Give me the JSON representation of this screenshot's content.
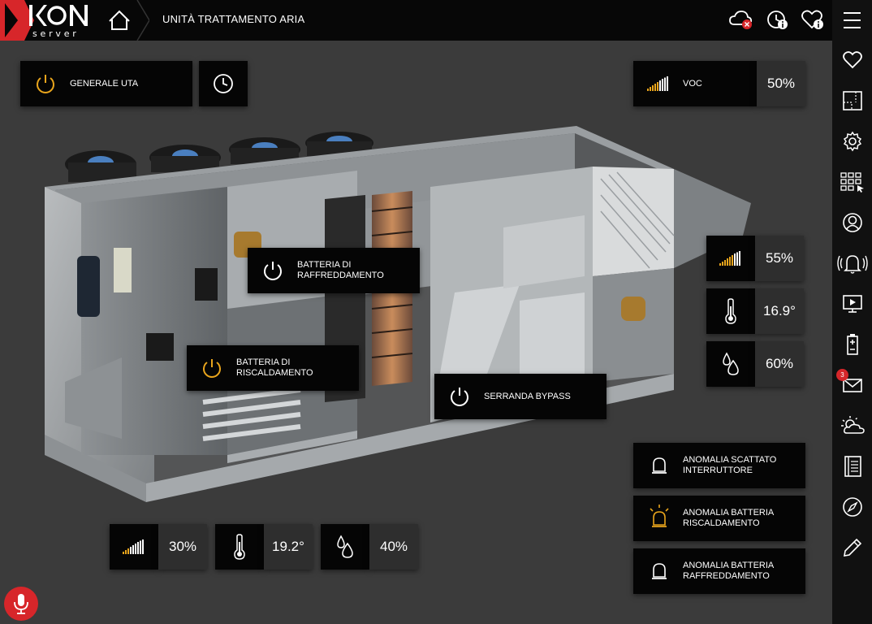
{
  "header": {
    "logo_text": "KON",
    "logo_sub": "server",
    "title": "UNITÀ TRATTAMENTO ARIA"
  },
  "sidebar": {
    "items": [
      {
        "icon": "heart-icon"
      },
      {
        "icon": "floorplan-icon"
      },
      {
        "icon": "gear-icon"
      },
      {
        "icon": "grid-select-icon"
      },
      {
        "icon": "user-icon"
      },
      {
        "icon": "bell-icon"
      },
      {
        "icon": "monitor-play-icon"
      },
      {
        "icon": "battery-icon"
      },
      {
        "icon": "mail-icon",
        "badge": "3"
      },
      {
        "icon": "weather-icon"
      },
      {
        "icon": "notebook-icon"
      },
      {
        "icon": "compass-icon"
      },
      {
        "icon": "pencil-icon"
      }
    ]
  },
  "controls": {
    "generale_uta": "GENERALE UTA",
    "batteria_raffreddamento": "BATTERIA DI\nRAFFREDDAMENTO",
    "batteria_riscaldamento": "BATTERIA DI\nRISCALDAMENTO",
    "serranda_bypass": "SERRANDA BYPASS"
  },
  "sensors": {
    "voc_label": "VOC",
    "voc_value": "50%",
    "right_level": "55%",
    "right_temp": "16.9°",
    "right_humidity": "60%",
    "bottom_level": "30%",
    "bottom_temp": "19.2°",
    "bottom_humidity": "40%"
  },
  "alarms": [
    {
      "label": "ANOMALIA SCATTATO\nINTERRUTTORE",
      "active": false
    },
    {
      "label": "ANOMALIA BATTERIA\nRISCALDAMENTO",
      "active": true
    },
    {
      "label": "ANOMALIA BATTERIA\nRAFFREDDAMENTO",
      "active": false
    }
  ],
  "colors": {
    "accent": "#e9a51c",
    "alert": "#d7262a",
    "panel": "#050505",
    "value_bg": "#2e2e2e"
  }
}
